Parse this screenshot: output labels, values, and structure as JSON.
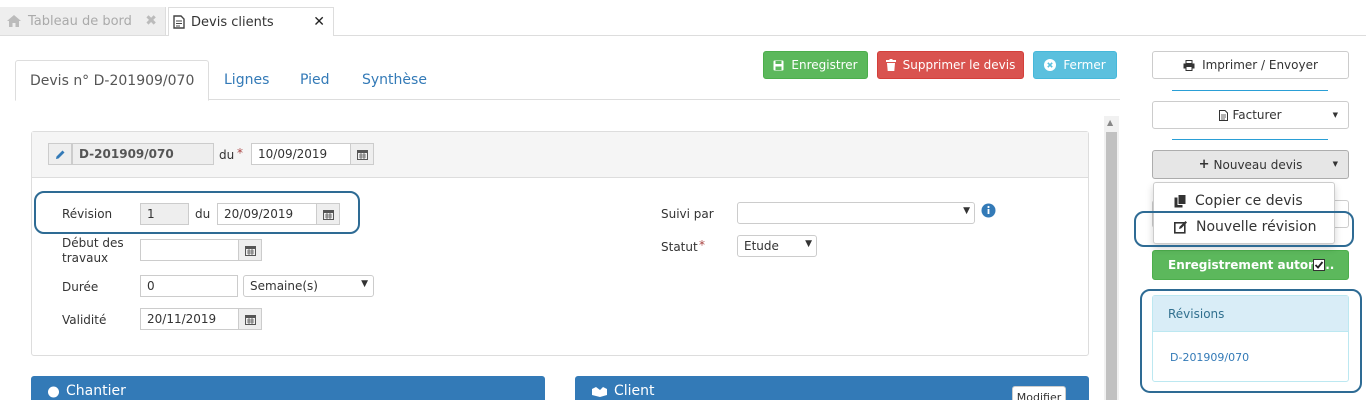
{
  "doc_tabs": [
    {
      "label": "Tableau de bord",
      "close": "✖"
    },
    {
      "label": "Devis clients",
      "close": "✕"
    }
  ],
  "nav_tabs": [
    "Devis n° D-201909/070",
    "Lignes",
    "Pied",
    "Synthèse"
  ],
  "actions": {
    "save": "Enregistrer",
    "delete": "Supprimer le devis",
    "close": "Fermer"
  },
  "header": {
    "quote_number": "D-201909/070",
    "du_label": "du",
    "required_mark": "*",
    "date": "10/09/2019"
  },
  "form": {
    "revision_label": "Révision",
    "revision_value": "1",
    "revision_du": "du",
    "revision_date": "20/09/2019",
    "start_label_1": "Début des",
    "start_label_2": "travaux",
    "start_value": "",
    "duration_label": "Durée",
    "duration_value": "0",
    "duration_unit": "Semaine(s)",
    "validity_label": "Validité",
    "validity_value": "20/11/2019",
    "followed_label": "Suivi par",
    "followed_value": "",
    "status_label": "Statut",
    "status_required": "*",
    "status_value": "Etude"
  },
  "panels": {
    "site": "Chantier",
    "client": "Client",
    "modify": "Modifier"
  },
  "sidebar": {
    "print": "Imprimer / Envoyer",
    "invoice": "Facturer",
    "new_quote": "Nouveau devis",
    "autosave": "Enregistrement autom...",
    "dropdown": [
      "Copier ce devis",
      "Nouvelle révision"
    ],
    "revisions_title": "Révisions",
    "revisions": [
      "D-201909/070"
    ]
  },
  "colors": {
    "primary": "#337ab7",
    "success": "#5cb85c",
    "danger": "#d9534f",
    "info": "#5bc0de",
    "callout": "#2e6b94"
  }
}
